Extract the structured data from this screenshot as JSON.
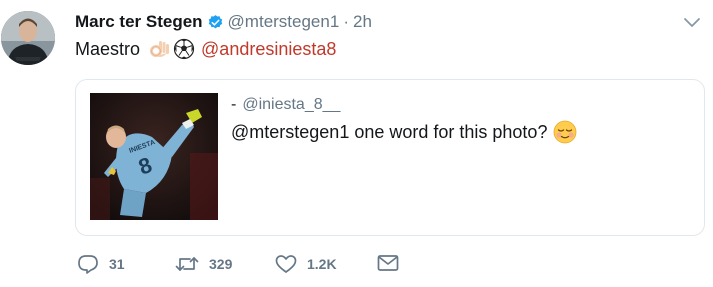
{
  "tweet": {
    "author_name": "Marc ter Stegen",
    "author_handle": "@mterstegen1",
    "separator": "·",
    "timestamp": "2h",
    "text": "Maestro",
    "emojis": [
      "ok-hand-emoji",
      "soccer-ball-emoji"
    ],
    "mention": "@andresiniesta8",
    "verified": true
  },
  "quoted_tweet": {
    "prefix": "-",
    "handle": "@iniesta_8__",
    "text": "@mterstegen1 one word for this photo?",
    "emoji": "relieved-face-emoji",
    "image_description": "photo of a footballer in sky-blue kit with number 8, performing an overhead kick"
  },
  "actions": {
    "replies": "31",
    "retweets": "329",
    "likes": "1.2K"
  },
  "colors": {
    "name": "#14171a",
    "secondary": "#657786",
    "mention": "#c0392b",
    "verified": "#1da1f2",
    "border": "#e1e8ed"
  }
}
